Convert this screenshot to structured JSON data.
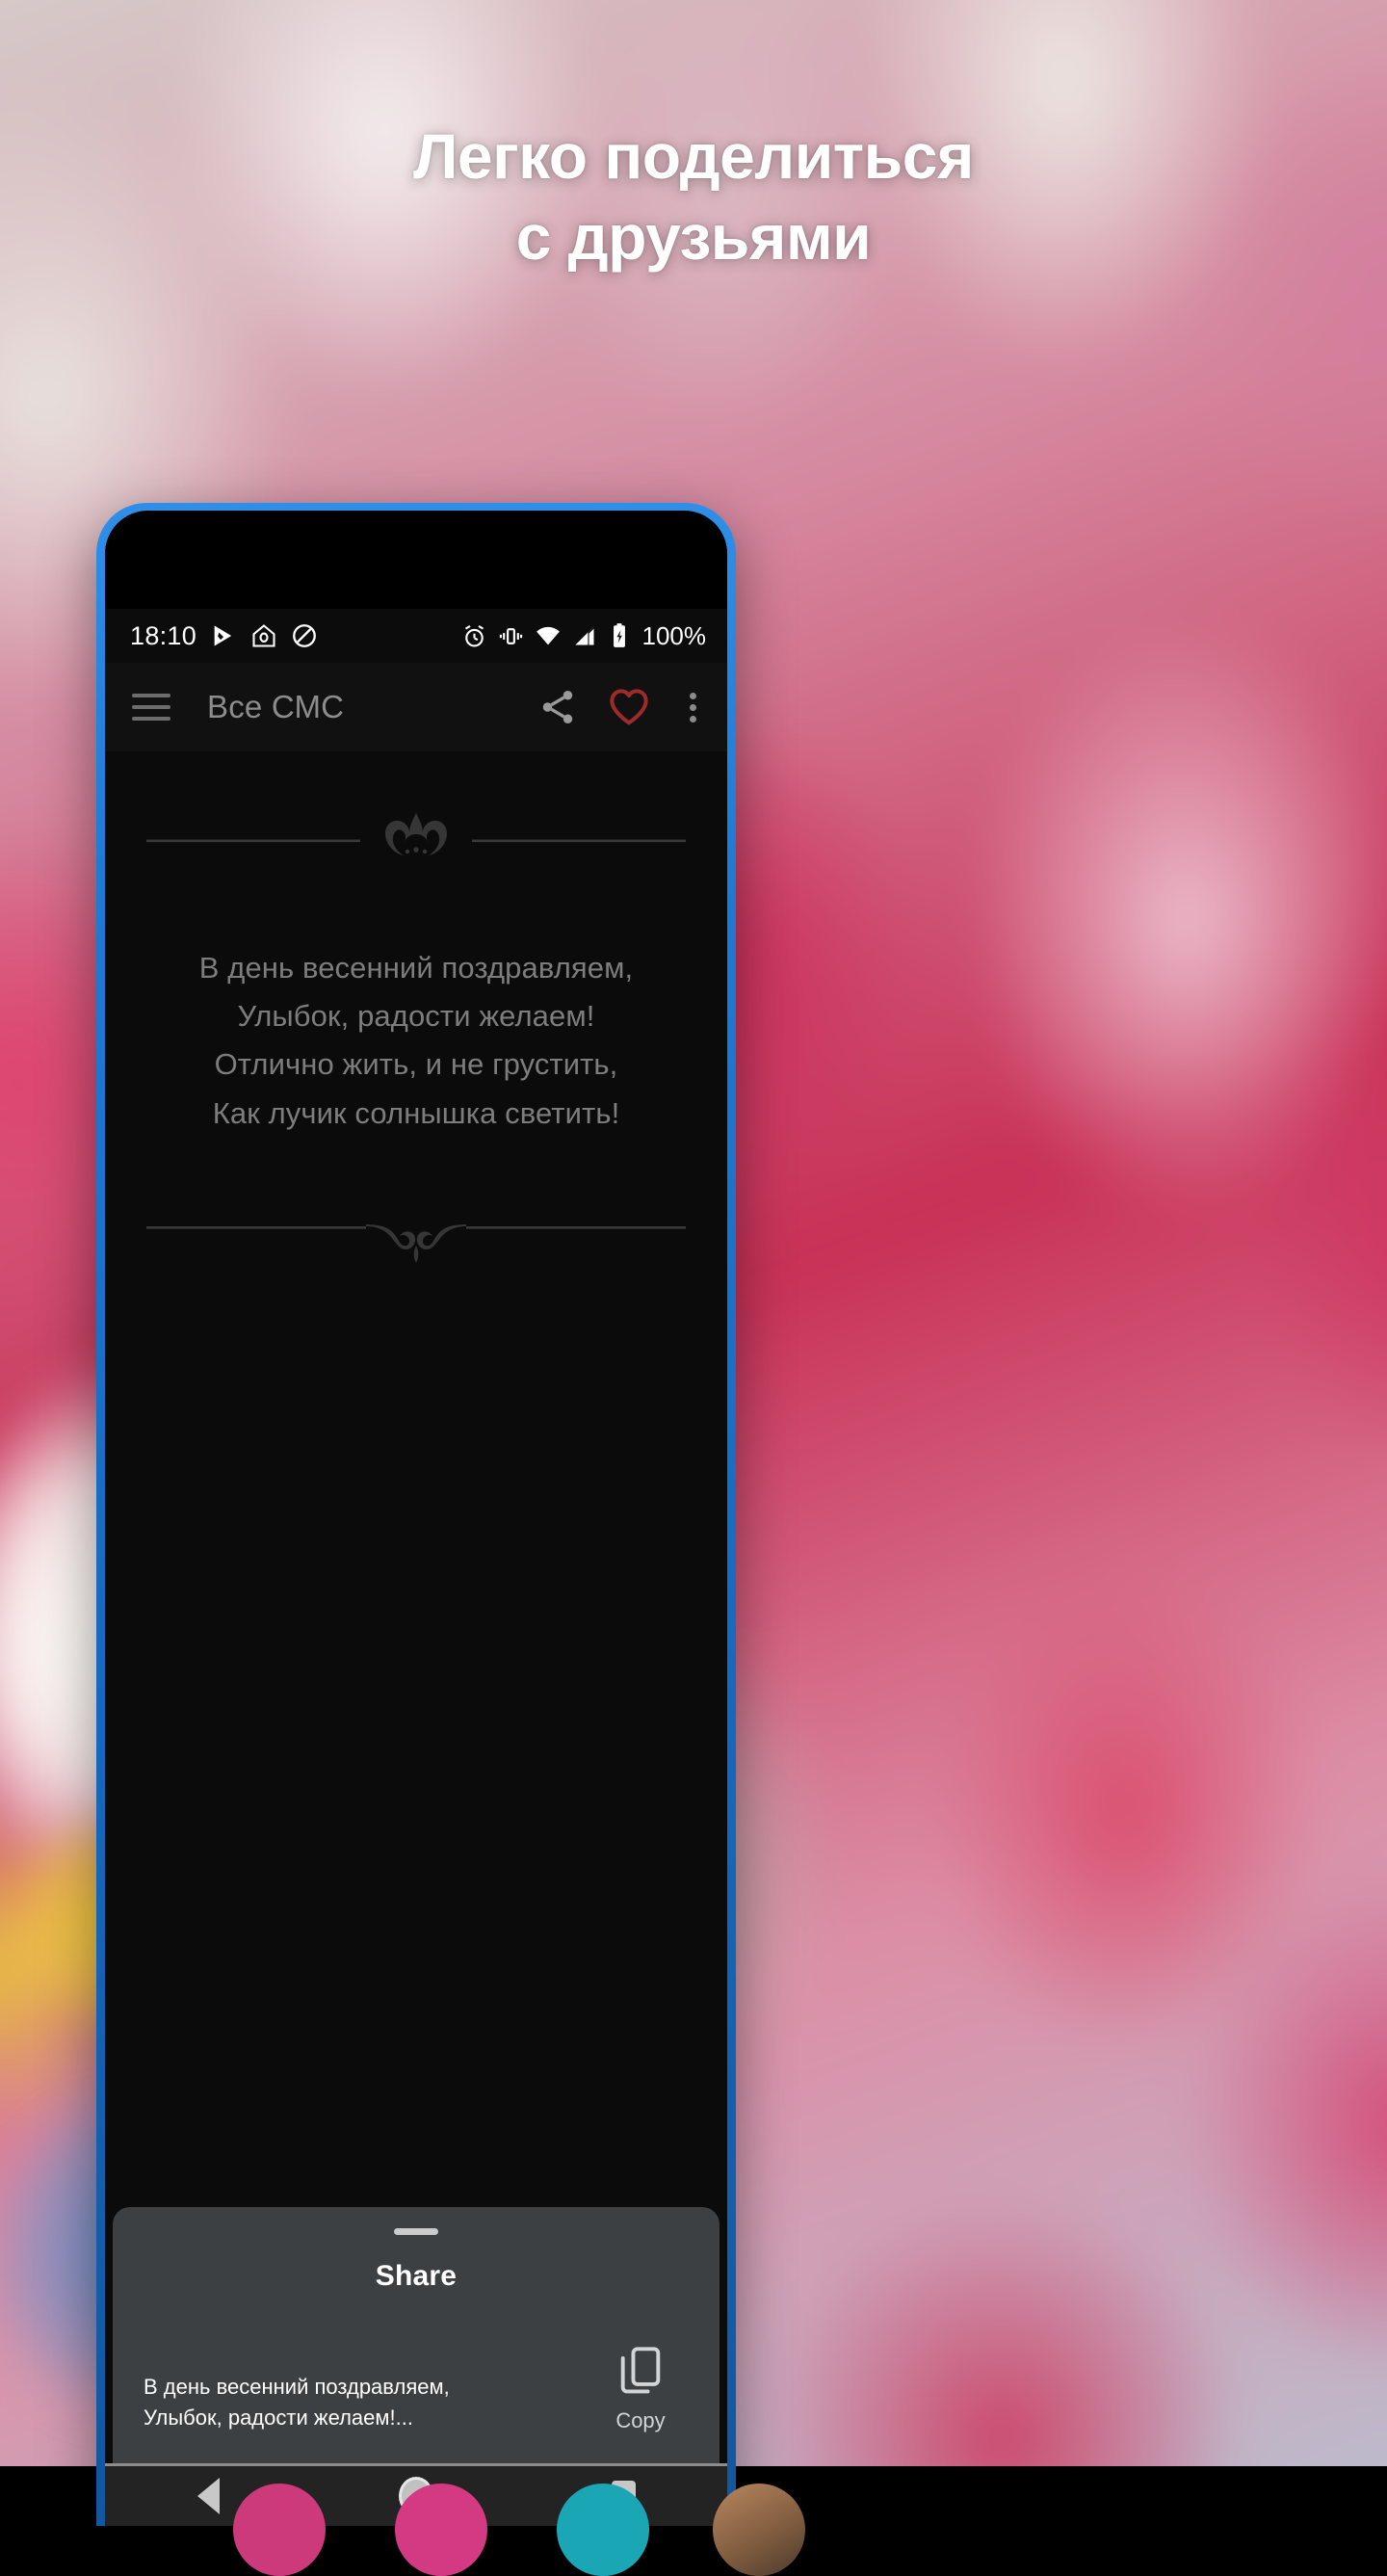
{
  "promo": {
    "headline_line1": "Легко поделиться",
    "headline_line2": "с друзьями"
  },
  "statusbar": {
    "time": "18:10",
    "battery_percent": "100%",
    "icons_left": [
      "play-store-icon",
      "home-security-icon",
      "do-not-disturb-icon"
    ],
    "icons_right": [
      "alarm-icon",
      "vibrate-icon",
      "wifi-icon",
      "cellular-signal-icon",
      "battery-charging-icon"
    ]
  },
  "appbar": {
    "menu_icon": "hamburger-menu-icon",
    "title": "Все СМС",
    "share_icon": "share-icon",
    "favorite_icon": "heart-outline-icon",
    "overflow_icon": "more-vertical-icon",
    "favorite_color": "#9e2a2a",
    "title_color": "#8c8c8c"
  },
  "message": {
    "lines": [
      "В день весенний поздравляем,",
      "Улыбок, радости желаем!",
      "Отлично жить, и не грустить,",
      "Как лучик солнышка светить!"
    ],
    "divider_top_icon": "crown-ornament-divider",
    "divider_bottom_icon": "flourish-ornament-divider",
    "text_color": "#7d7d7d"
  },
  "share_sheet": {
    "handle": "drag-handle",
    "title": "Share",
    "preview_line1": "В день весенний поздравляем,",
    "preview_line2": "Улыбок, радости желаем!...",
    "copy_icon": "copy-icon",
    "copy_label": "Copy",
    "background_color": "#3c4043"
  },
  "navbar": {
    "back_label": "back-button",
    "home_label": "home-button",
    "recents_label": "recents-button"
  }
}
